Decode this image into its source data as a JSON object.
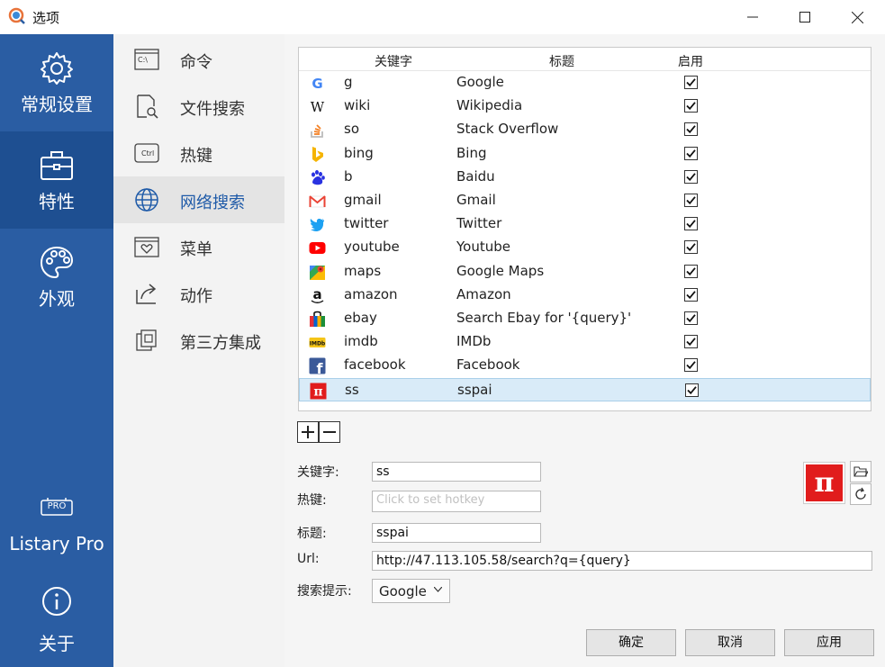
{
  "window": {
    "title": "选项"
  },
  "leftnav": {
    "items": [
      {
        "label": "常规设置",
        "icon": "gear-icon"
      },
      {
        "label": "特性",
        "icon": "toolbox-icon"
      },
      {
        "label": "外观",
        "icon": "palette-icon"
      },
      {
        "label": "Listary Pro",
        "icon": "pro-badge-icon"
      },
      {
        "label": "关于",
        "icon": "info-icon"
      }
    ],
    "pro_badge": "PRO",
    "active": "特性"
  },
  "subnav": {
    "items": [
      {
        "label": "命令",
        "icon": "command-prompt-icon"
      },
      {
        "label": "文件搜索",
        "icon": "file-search-icon"
      },
      {
        "label": "热键",
        "icon": "ctrl-key-icon"
      },
      {
        "label": "网络搜索",
        "icon": "globe-icon"
      },
      {
        "label": "菜单",
        "icon": "menu-heart-icon"
      },
      {
        "label": "动作",
        "icon": "share-arrow-icon"
      },
      {
        "label": "第三方集成",
        "icon": "integration-icon"
      }
    ],
    "cmd_text": "C:\\",
    "ctrl_text": "Ctrl",
    "active": "网络搜索"
  },
  "table": {
    "headers": {
      "keyword": "关键字",
      "title": "标题",
      "enabled": "启用"
    },
    "rows": [
      {
        "keyword": "g",
        "title": "Google",
        "enabled": true,
        "icon": "google-icon"
      },
      {
        "keyword": "wiki",
        "title": "Wikipedia",
        "enabled": true,
        "icon": "wikipedia-icon"
      },
      {
        "keyword": "so",
        "title": "Stack Overflow",
        "enabled": true,
        "icon": "stackoverflow-icon"
      },
      {
        "keyword": "bing",
        "title": "Bing",
        "enabled": true,
        "icon": "bing-icon"
      },
      {
        "keyword": "b",
        "title": "Baidu",
        "enabled": true,
        "icon": "baidu-icon"
      },
      {
        "keyword": "gmail",
        "title": "Gmail",
        "enabled": true,
        "icon": "gmail-icon"
      },
      {
        "keyword": "twitter",
        "title": "Twitter",
        "enabled": true,
        "icon": "twitter-icon"
      },
      {
        "keyword": "youtube",
        "title": "Youtube",
        "enabled": true,
        "icon": "youtube-icon"
      },
      {
        "keyword": "maps",
        "title": "Google Maps",
        "enabled": true,
        "icon": "maps-icon"
      },
      {
        "keyword": "amazon",
        "title": "Amazon",
        "enabled": true,
        "icon": "amazon-icon"
      },
      {
        "keyword": "ebay",
        "title": "Search Ebay for '{query}'",
        "enabled": true,
        "icon": "ebay-icon"
      },
      {
        "keyword": "imdb",
        "title": "IMDb",
        "enabled": true,
        "icon": "imdb-icon"
      },
      {
        "keyword": "facebook",
        "title": "Facebook",
        "enabled": true,
        "icon": "facebook-icon"
      },
      {
        "keyword": "ss",
        "title": "sspai",
        "enabled": true,
        "icon": "sspai-icon",
        "selected": true
      }
    ],
    "icon_glyphs": {
      "google": "G",
      "wikipedia": "W",
      "amazon": "a",
      "imdb": "IMDb",
      "facebook": "f",
      "sspai": "π"
    }
  },
  "form": {
    "keyword_label": "关键字:",
    "keyword_value": "ss",
    "hotkey_label": "热键:",
    "hotkey_placeholder": "Click to set hotkey",
    "title_label": "标题:",
    "title_value": "sspai",
    "url_label": "Url:",
    "url_value": "http://47.113.105.58/search?q={query}",
    "suggest_label": "搜索提示:",
    "suggest_value": "Google",
    "icon_glyph": "π"
  },
  "buttons": {
    "ok": "确定",
    "cancel": "取消",
    "apply": "应用"
  },
  "colors": {
    "nav_bg": "#2a5da3",
    "nav_active": "#1e4f91",
    "selected_row": "#d9ebf8",
    "sspai_red": "#e11c1c"
  }
}
